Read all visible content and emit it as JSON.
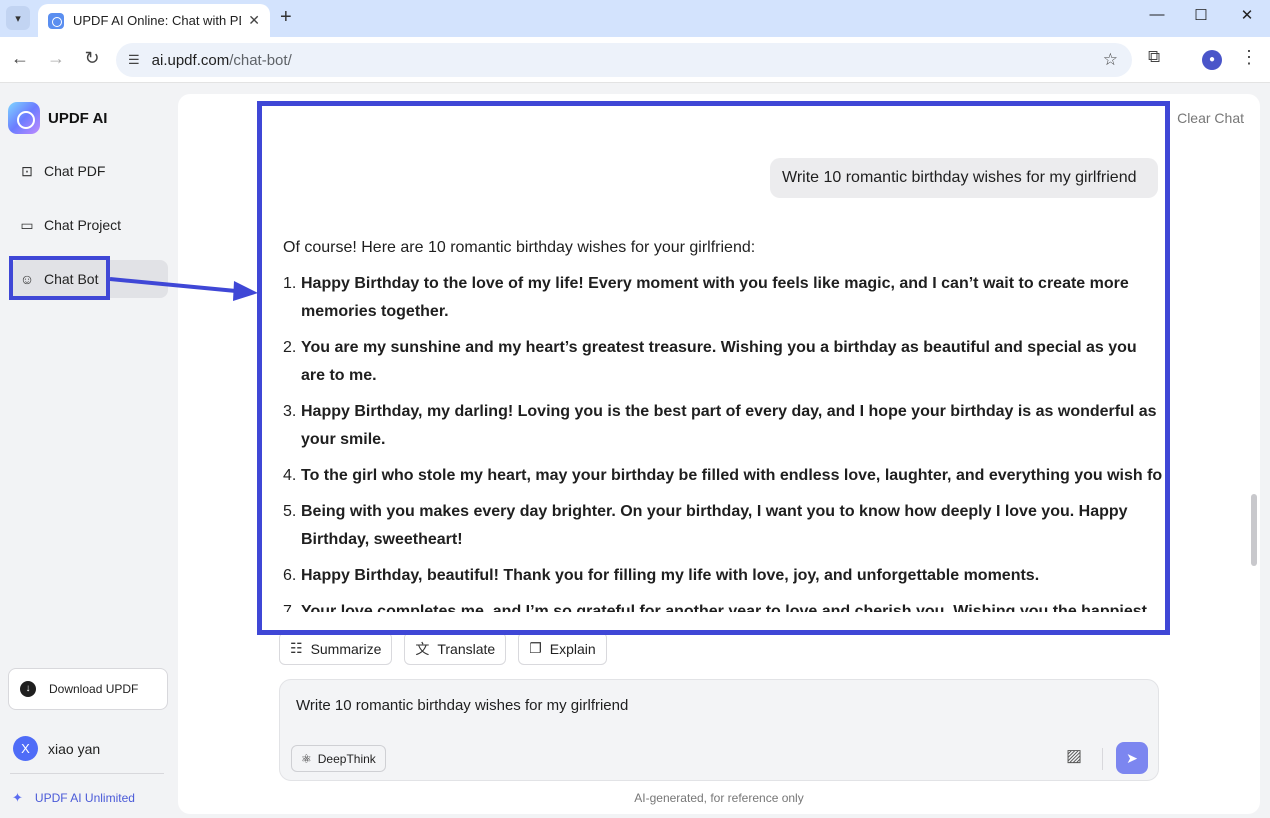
{
  "browser": {
    "tab_title": "UPDF AI Online: Chat with PDF",
    "url_domain": "ai.updf.com",
    "url_path": "/chat-bot/",
    "icons": {
      "tab_menu": "chevron-down-icon",
      "close": "close-icon",
      "new_tab": "plus-icon",
      "back": "arrow-left-icon",
      "forward": "arrow-right-icon",
      "reload": "reload-icon",
      "site_info": "tune-icon",
      "bookmark": "star-icon",
      "extensions": "puzzle-icon",
      "menu": "kebab-icon"
    }
  },
  "sidebar": {
    "brand": "UPDF AI",
    "items": [
      {
        "label": "Chat PDF",
        "icon": "book-icon"
      },
      {
        "label": "Chat Project",
        "icon": "folder-icon"
      },
      {
        "label": "Chat Bot",
        "icon": "bot-icon",
        "active": true
      }
    ],
    "download_label": "Download UPDF",
    "user": {
      "initial": "X",
      "name": "xiao yan"
    },
    "unlimited_label": "UPDF AI Unlimited"
  },
  "chat": {
    "clear_label": "Clear Chat",
    "user_message": "Write 10 romantic birthday wishes for my girlfriend",
    "answer_intro": "Of course! Here are 10 romantic birthday wishes for your girlfriend:",
    "wishes": [
      {
        "num": "1.",
        "text": "Happy Birthday to the love of my life! Every moment with you feels like magic, and I can’t wait to create more memories together."
      },
      {
        "num": "2.",
        "text": "You are my sunshine and my heart’s greatest treasure. Wishing you a birthday as beautiful and special as you are to me."
      },
      {
        "num": "3.",
        "text": "Happy Birthday, my darling! Loving you is the best part of every day, and I hope your birthday is as wonderful as your smile."
      },
      {
        "num": "4.",
        "text": "To the girl who stole my heart, may your birthday be filled with endless love, laughter, and everything you wish for."
      },
      {
        "num": "5.",
        "text": "Being with you makes every day brighter. On your birthday, I want you to know how deeply I love you. Happy Birthday, sweetheart!"
      },
      {
        "num": "6.",
        "text": "Happy Birthday, beautiful! Thank you for filling my life with love, joy, and unforgettable moments."
      },
      {
        "num": "7.",
        "text": "Your love completes me, and I’m so grateful for another year to love and cherish you. Wishing you the happiest of"
      }
    ],
    "actions": [
      "Summarize",
      "Translate",
      "Explain"
    ],
    "composer_text": "Write 10 romantic birthday wishes for my girlfriend",
    "deepthink_label": "DeepThink",
    "disclaimer": "AI-generated, for reference only"
  },
  "colors": {
    "annotation": "#3f47d6",
    "accent": "#7c86f0",
    "active_item": "#e1e2e6"
  }
}
